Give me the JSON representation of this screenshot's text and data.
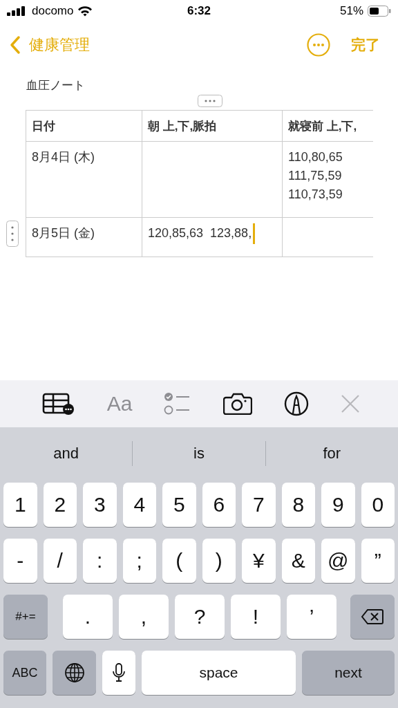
{
  "status_bar": {
    "carrier": "docomo",
    "time": "6:32",
    "battery": "51%"
  },
  "nav": {
    "back_label": "健康管理",
    "done_label": "完了"
  },
  "note": {
    "title": "血圧ノート",
    "table": {
      "columns": [
        "日付",
        "朝 上,下,脈拍",
        "就寝前 上,下,"
      ],
      "rows": [
        {
          "cells": [
            {
              "lines": [
                "8月4日 (木)"
              ],
              "focused": false
            },
            {
              "focused": false
            },
            {
              "lines": [
                "110,80,65",
                "111,75,59",
                "110,73,59"
              ],
              "focused": false
            }
          ]
        },
        {
          "cells": [
            {
              "lines": [
                "8月5日 (金)"
              ],
              "focused": false
            },
            {
              "lines": [
                "120,85,63  123,88,"
              ],
              "focused": true
            },
            {
              "focused": false
            }
          ]
        }
      ]
    }
  },
  "toolbar": [
    {
      "kind": "table"
    },
    {
      "kind": "format",
      "label": "Aa"
    },
    {
      "kind": "checklist"
    },
    {
      "kind": "camera"
    },
    {
      "kind": "markup"
    },
    {
      "kind": "close",
      "disabled": true
    }
  ],
  "suggestions": [
    "and",
    "is",
    "for"
  ],
  "keyboard": [
    [
      {
        "kind": "char",
        "label": "1"
      },
      {
        "kind": "char",
        "label": "2"
      },
      {
        "kind": "char",
        "label": "3"
      },
      {
        "kind": "char",
        "label": "4"
      },
      {
        "kind": "char",
        "label": "5"
      },
      {
        "kind": "char",
        "label": "6"
      },
      {
        "kind": "char",
        "label": "7"
      },
      {
        "kind": "char",
        "label": "8"
      },
      {
        "kind": "char",
        "label": "9"
      },
      {
        "kind": "char",
        "label": "0"
      }
    ],
    [
      {
        "kind": "char",
        "label": "-"
      },
      {
        "kind": "char",
        "label": "/"
      },
      {
        "kind": "char",
        "label": ":"
      },
      {
        "kind": "char",
        "label": ";"
      },
      {
        "kind": "char",
        "label": "("
      },
      {
        "kind": "char",
        "label": ")"
      },
      {
        "kind": "char",
        "label": "¥"
      },
      {
        "kind": "char",
        "label": "&"
      },
      {
        "kind": "char",
        "label": "@"
      },
      {
        "kind": "char",
        "label": "”"
      }
    ],
    [
      {
        "kind": "mode",
        "label": "#+="
      },
      {
        "kind": "char",
        "label": "."
      },
      {
        "kind": "char",
        "label": ","
      },
      {
        "kind": "char",
        "label": "?"
      },
      {
        "kind": "char",
        "label": "!"
      },
      {
        "kind": "char",
        "label": "’"
      },
      {
        "kind": "delete"
      }
    ],
    [
      {
        "kind": "abc",
        "label": "ABC"
      },
      {
        "kind": "globe"
      },
      {
        "kind": "mic"
      },
      {
        "kind": "space",
        "label": "space"
      },
      {
        "kind": "return",
        "label": "next"
      }
    ]
  ]
}
